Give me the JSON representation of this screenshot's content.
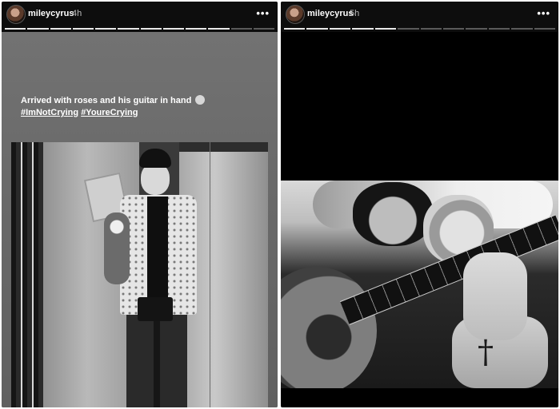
{
  "stories": [
    {
      "username": "mileycyrus",
      "time": "4h",
      "more_icon": "more-horizontal-icon",
      "progress": {
        "segments": 12,
        "completed": 10
      },
      "caption_line1": "Arrived with roses and his guitar in hand",
      "caption_emoji": "smiling-face-with-tear-emoji",
      "hashtags": [
        "#ImNotCrying",
        "#YoureCrying"
      ]
    },
    {
      "username": "mileycyrus",
      "time": "5h",
      "more_icon": "more-horizontal-icon",
      "progress": {
        "segments": 12,
        "completed": 5
      }
    }
  ],
  "colors": {
    "header_bg": "#0d0d0d",
    "left_story_bg": "#6f6f6f",
    "right_story_bg": "#000000",
    "progress_done": "#e8e8e8",
    "progress_pending": "#5a5a5a"
  }
}
